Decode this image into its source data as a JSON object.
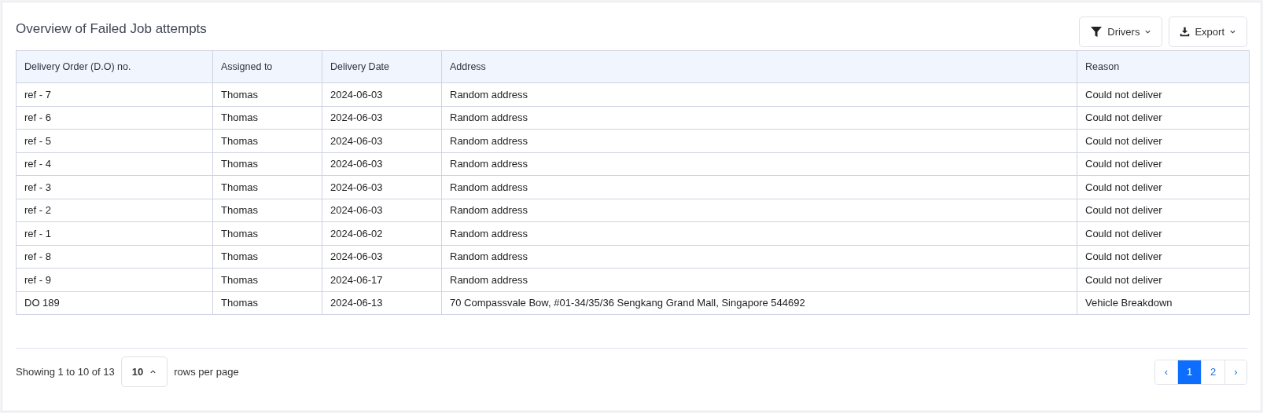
{
  "title": "Overview of Failed Job attempts",
  "toolbar": [
    {
      "kind": "filter",
      "label": "Drivers"
    },
    {
      "kind": "export",
      "label": "Export"
    }
  ],
  "table": {
    "columns": [
      "Delivery Order (D.O) no.",
      "Assigned to",
      "Delivery Date",
      "Address",
      "Reason"
    ],
    "rows": [
      [
        "ref - 7",
        "Thomas",
        "2024-06-03",
        "Random address",
        "Could not deliver"
      ],
      [
        "ref - 6",
        "Thomas",
        "2024-06-03",
        "Random address",
        "Could not deliver"
      ],
      [
        "ref - 5",
        "Thomas",
        "2024-06-03",
        "Random address",
        "Could not deliver"
      ],
      [
        "ref - 4",
        "Thomas",
        "2024-06-03",
        "Random address",
        "Could not deliver"
      ],
      [
        "ref - 3",
        "Thomas",
        "2024-06-03",
        "Random address",
        "Could not deliver"
      ],
      [
        "ref - 2",
        "Thomas",
        "2024-06-03",
        "Random address",
        "Could not deliver"
      ],
      [
        "ref - 1",
        "Thomas",
        "2024-06-02",
        "Random address",
        "Could not deliver"
      ],
      [
        "ref - 8",
        "Thomas",
        "2024-06-03",
        "Random address",
        "Could not deliver"
      ],
      [
        "ref - 9",
        "Thomas",
        "2024-06-17",
        "Random address",
        "Could not deliver"
      ],
      [
        "DO 189",
        "Thomas",
        "2024-06-13",
        "70 Compassvale Bow, #01-34/35/36 Sengkang Grand Mall, Singapore 544692",
        "Vehicle Breakdown"
      ]
    ]
  },
  "footer": {
    "summary": "Showing 1 to 10 of 13",
    "page_size": "10",
    "page_size_suffix": "rows per page",
    "pages": [
      {
        "kind": "prev",
        "label": "‹",
        "selected": false
      },
      {
        "kind": "page",
        "label": "1",
        "selected": true
      },
      {
        "kind": "page",
        "label": "2",
        "selected": false
      },
      {
        "kind": "next",
        "label": "›",
        "selected": false
      }
    ]
  }
}
